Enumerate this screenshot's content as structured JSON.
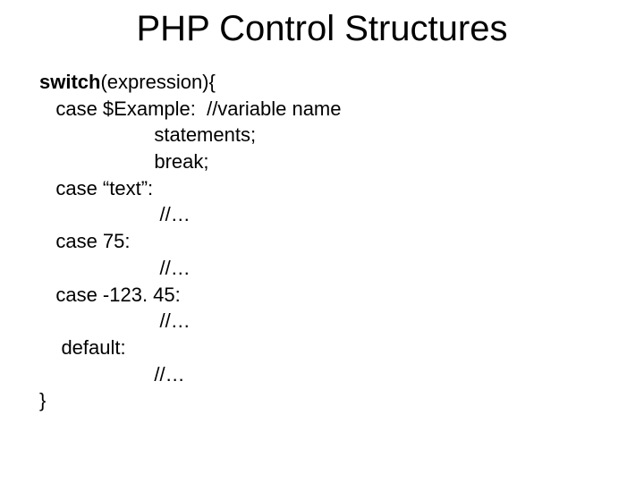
{
  "title": "PHP Control Structures",
  "code": {
    "l1_kw": "switch",
    "l1_rest": "(expression){",
    "l2": "   case $Example:  //variable name",
    "l3": "                     statements;",
    "l4": "                     break;",
    "l5": "   case “text”:",
    "l6": "                      //…",
    "l7": "   case 75:",
    "l8": "                      //…",
    "l9": "   case -123. 45:",
    "l10": "                      //…",
    "l11": "    default:",
    "l12": "                     //…",
    "l13": "}"
  }
}
